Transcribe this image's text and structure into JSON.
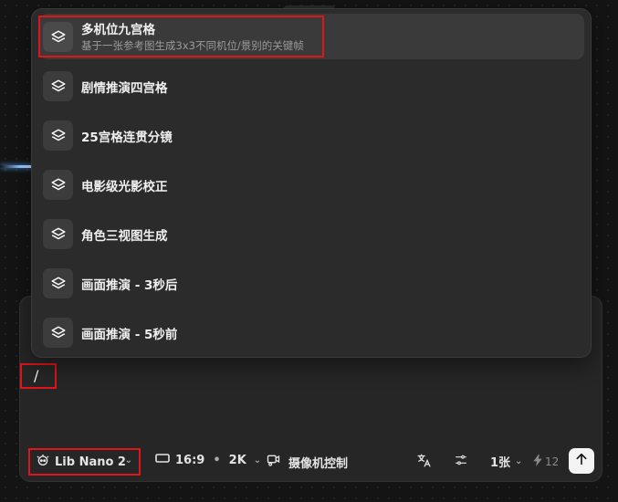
{
  "menu": {
    "items": [
      {
        "title": "多机位九宫格",
        "desc": "基于一张参考图生成3x3不同机位/景别的关键帧"
      },
      {
        "title": "剧情推演四宫格"
      },
      {
        "title": "25宫格连贯分镜"
      },
      {
        "title": "电影级光影校正"
      },
      {
        "title": "角色三视图生成"
      },
      {
        "title": "画面推演 - 3秒后"
      },
      {
        "title": "画面推演 - 5秒前"
      }
    ]
  },
  "composer": {
    "input_value": "/"
  },
  "toolbar": {
    "model_label": "Lib Nano 2",
    "ratio": "16:9",
    "dot": "•",
    "resolution": "2K",
    "camera_label": "摄像机控制",
    "count_label": "1张",
    "credits": "12"
  },
  "colors": {
    "highlight": "#e0141b",
    "panel": "#262626",
    "menu": "#2b2b2b"
  }
}
